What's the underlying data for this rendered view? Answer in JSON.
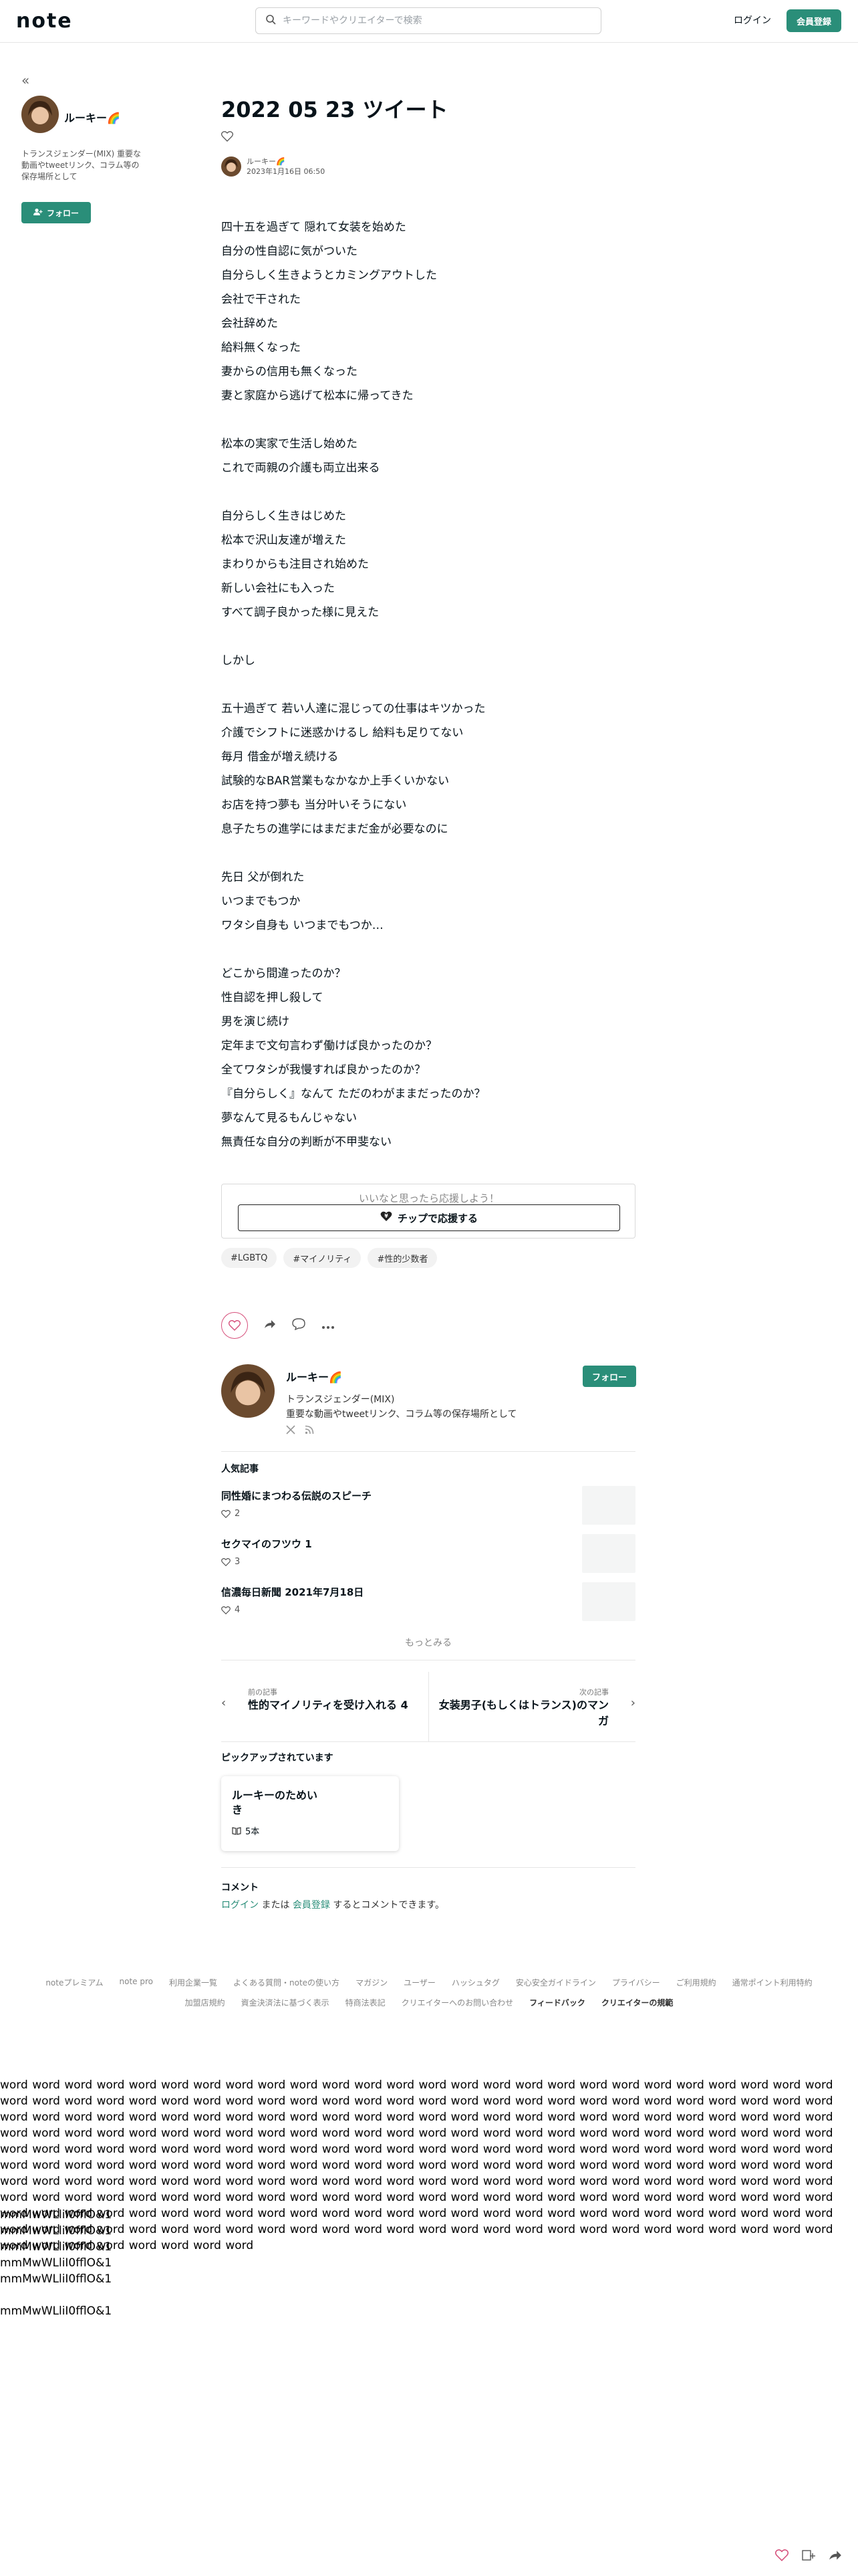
{
  "header": {
    "logo": "note",
    "search_placeholder": "キーワードやクリエイターで検索",
    "login": "ログイン",
    "signup": "会員登録"
  },
  "sidebar": {
    "name": "ルーキー🌈",
    "description": "トランスジェンダー(MIX) 重要な動画やtweetリンク、コラム等の保存場所として",
    "follow": "フォロー"
  },
  "article": {
    "title": "2022 05 23 ツイート",
    "author": "ルーキー🌈",
    "date": "2023年1月16日 06:50",
    "lines": [
      "四十五を過ぎて 隠れて女装を始めた",
      "自分の性自認に気がついた",
      "自分らしく生きようとカミングアウトした",
      "会社で干された",
      "会社辞めた",
      "給料無くなった",
      "妻からの信用も無くなった",
      "妻と家庭から逃げて松本に帰ってきた",
      "",
      "松本の実家で生活し始めた",
      "これで両親の介護も両立出来る",
      "",
      "自分らしく生きはじめた",
      "松本で沢山友達が増えた",
      "まわりからも注目され始めた",
      "新しい会社にも入った",
      "すべて調子良かった様に見えた",
      "",
      "しかし",
      "",
      "五十過ぎて 若い人達に混じっての仕事はキツかった",
      "介護でシフトに迷惑かけるし 給料も足りてない",
      "毎月 借金が増え続ける",
      "試験的なBAR営業もなかなか上手くいかない",
      "お店を持つ夢も 当分叶いそうにない",
      "息子たちの進学にはまだまだ金が必要なのに",
      "",
      "先日 父が倒れた",
      "いつまでもつか",
      "ワタシ自身も いつまでもつか…",
      "",
      "どこから間違ったのか？",
      "性自認を押し殺して",
      "男を演じ続け",
      "定年まで文句言わず働けば良かったのか？",
      "全てワタシが我慢すれば良かったのか？",
      "『自分らしく』なんて ただのわがままだったのか？",
      "夢なんて見るもんじゃない",
      "無責任な自分の判断が不甲斐ない"
    ]
  },
  "support": {
    "label": "いいなと思ったら応援しよう！",
    "button": "チップで応援する"
  },
  "tags": [
    "#LGBTQ",
    "#マイノリティ",
    "#性的少数者"
  ],
  "author_card": {
    "name": "ルーキー🌈",
    "line1": "トランスジェンダー(MIX)",
    "line2": "重要な動画やtweetリンク、コラム等の保存場所として",
    "follow": "フォロー"
  },
  "popular": {
    "title": "人気記事",
    "items": [
      {
        "title": "同性婚にまつわる伝説のスピーチ",
        "likes": "2"
      },
      {
        "title": "セクマイのフツウ 1",
        "likes": "3"
      },
      {
        "title": "信濃毎日新聞 2021年7月18日",
        "likes": "4"
      }
    ],
    "more": "もっとみる"
  },
  "nav": {
    "prev_caption": "前の記事",
    "prev_title": "性的マイノリティを受け入れる 4",
    "next_caption": "次の記事",
    "next_title_1": "女装男子(もしくはトランス)のマン",
    "next_title_2": "ガ"
  },
  "pickup": {
    "title": "ピックアップされています",
    "name_1": "ルーキーのためい",
    "name_2": "き",
    "count": "5本"
  },
  "comments": {
    "title": "コメント",
    "login": "ログイン",
    "or": " または ",
    "register": "会員登録",
    "rest": " するとコメントできます。"
  },
  "footer": {
    "row1": [
      "noteプレミアム",
      "note pro",
      "利用企業一覧",
      "よくある質問・noteの使い方",
      "マガジン",
      "ユーザー",
      "ハッシュタグ",
      "安心安全ガイドライン",
      "プライバシー",
      "ご利用規約",
      "通常ポイント利用特約"
    ],
    "row2": [
      "加盟店規約",
      "資金決済法に基づく表示",
      "特商法表記",
      "クリエイターへのお問い合わせ",
      "フィードバック",
      "クリエイターの規範"
    ]
  },
  "filler_words": "word word word word word word word word word word word word word word word word word word word word word word word word word word word word word word word word word word word word word word word word word word word word word word word word word word word word word word word word word word word word word word word word word word word word word word word word word word word word word word word word word word word word word word word word word word word word word word word word word word word word word word word word word word word word word word word word word word word word word word word word word word word word word word word word word word word word word word word word word word word word word word word word word word word word word word word word word word word word word word word word word word word word word word word word word word word word word word word word word word word word word word word word word word word word word word word word word word word word word word word word word word word word word word word word word word word word word word word word word word word word word word word word word word word word word word word word word word word word word word word word word word word word word word word word word word word word word word word word word word word word word word word word word word word word",
  "filler_lines": [
    "mmMwWLliI0fflO&1",
    "mmMwWLliI0fflO&1",
    "mmMwWLliI0fflO&1",
    "mmMwWLliI0fflO&1",
    "mmMwWLliI0fflO&1",
    "mmMwWLliI0fflO&1"
  ]
}
